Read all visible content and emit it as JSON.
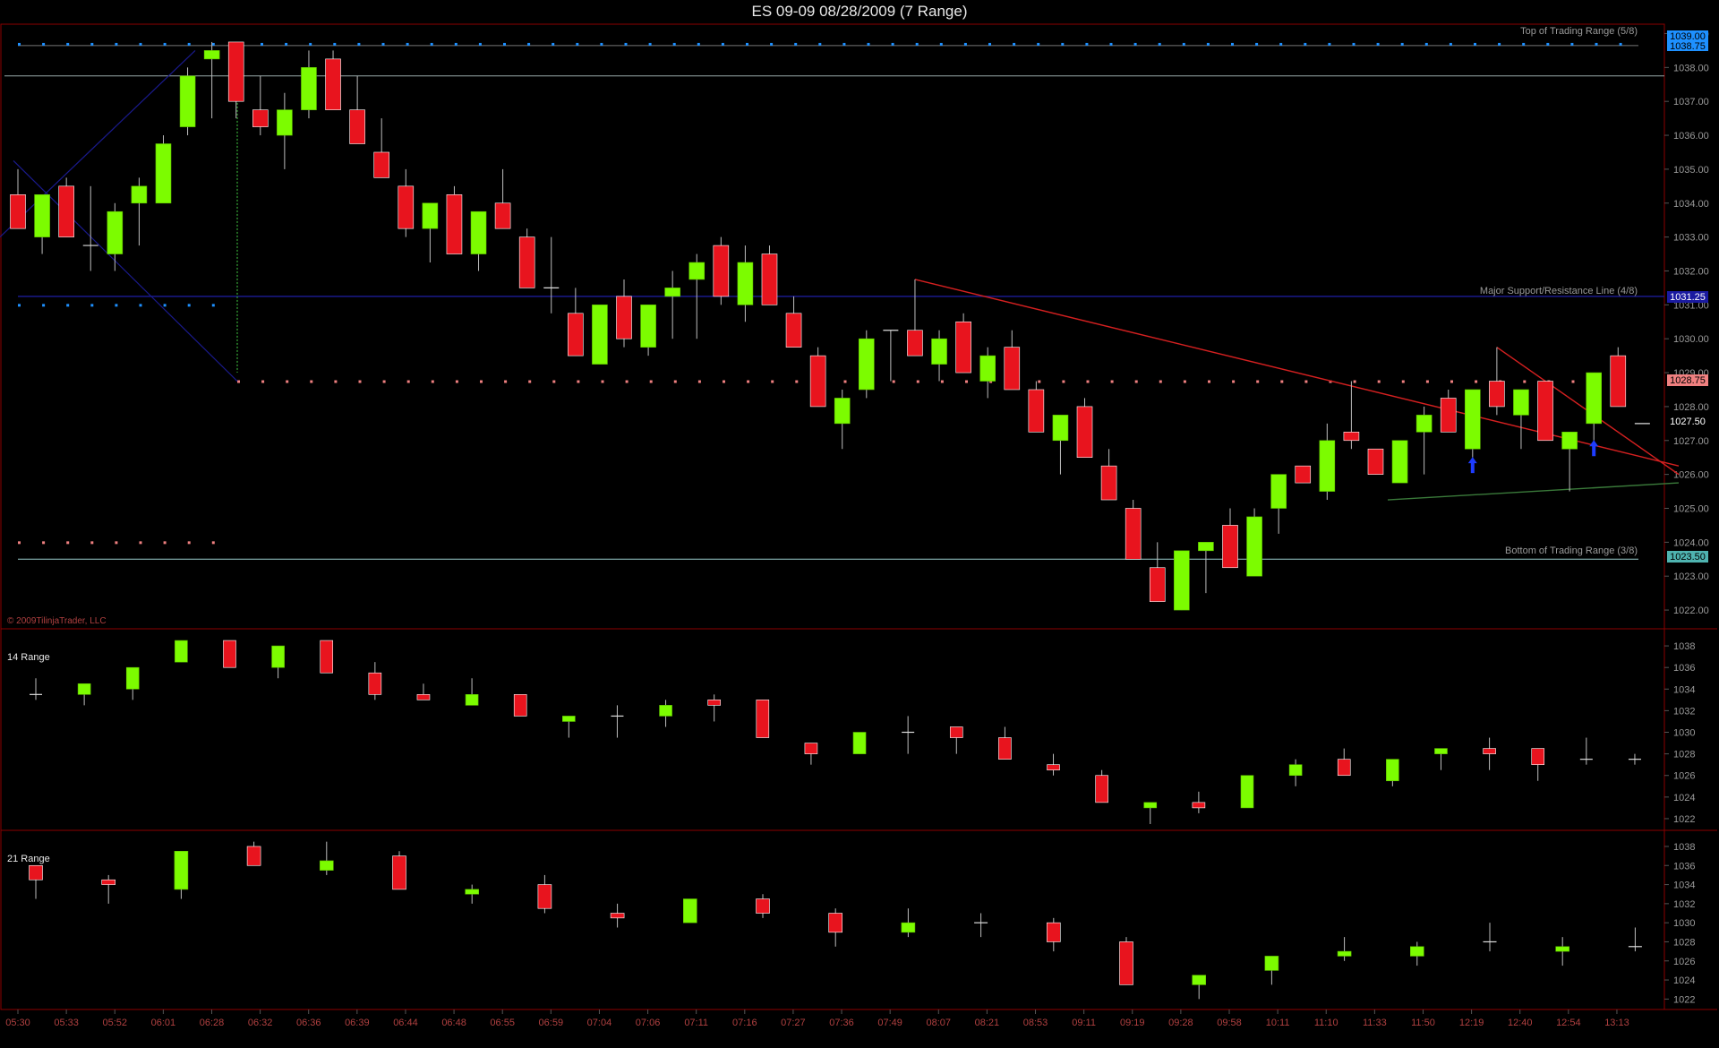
{
  "window": {
    "title": "ES 09-09  08/28/2009 (7 Range)"
  },
  "colors": {
    "up": "#7cfc00",
    "down": "#e8141e",
    "grid": "#8a8f8f",
    "frame": "#8b0000",
    "support": "#1a1a8c",
    "blueDots": "#1e90ff",
    "pinkDots": "#f08080",
    "trend": "#d42020",
    "greenLine": "#3a7a3a"
  },
  "panels": {
    "main": {
      "label": "",
      "copyright": "© 2009TilinjaTrader, LLC"
    },
    "p14": {
      "label": "14 Range"
    },
    "p21": {
      "label": "21 Range"
    }
  },
  "annotations": {
    "top": "Top of Trading Range (5/8)",
    "major": "Major Support/Resistance Line (4/8)",
    "bottom": "Bottom of Trading Range (3/8)"
  },
  "price_tags": {
    "top1": "1039.00",
    "top2": "1038.75",
    "major": "1031.25",
    "pink": "1028.75",
    "last": "1027.50",
    "bottom": "1023.50"
  },
  "chart_data": [
    {
      "type": "candlestick",
      "title": "ES 09-09  08/28/2009 (7 Range)",
      "ylim": [
        1021.5,
        1039.25
      ],
      "yticks": [
        "1039.00",
        "1038.00",
        "1037.00",
        "1036.00",
        "1035.00",
        "1034.00",
        "1033.00",
        "1032.00",
        "1031.00",
        "1030.00",
        "1029.00",
        "1028.00",
        "1027.00",
        "1026.00",
        "1025.00",
        "1024.00",
        "1023.00",
        "1022.00"
      ],
      "levels": [
        1038.75,
        1037.75,
        1031.25,
        1028.75,
        1024.0,
        1023.5
      ],
      "candles": [
        {
          "o": 1034.25,
          "h": 1035.0,
          "l": 1033.25,
          "c": 1033.25
        },
        {
          "o": 1033.0,
          "h": 1034.25,
          "l": 1032.5,
          "c": 1034.25
        },
        {
          "o": 1034.5,
          "h": 1034.75,
          "l": 1033.0,
          "c": 1033.0
        },
        {
          "o": 1032.75,
          "h": 1034.5,
          "l": 1032.0,
          "c": 1032.75
        },
        {
          "o": 1032.5,
          "h": 1034.0,
          "l": 1032.0,
          "c": 1033.75
        },
        {
          "o": 1034.0,
          "h": 1034.75,
          "l": 1032.75,
          "c": 1034.5
        },
        {
          "o": 1034.0,
          "h": 1036.0,
          "l": 1034.0,
          "c": 1035.75
        },
        {
          "o": 1036.25,
          "h": 1038.0,
          "l": 1036.0,
          "c": 1037.75
        },
        {
          "o": 1038.25,
          "h": 1038.75,
          "l": 1036.5,
          "c": 1038.5
        },
        {
          "o": 1038.75,
          "h": 1038.75,
          "l": 1036.5,
          "c": 1037.0
        },
        {
          "o": 1036.75,
          "h": 1037.75,
          "l": 1036.0,
          "c": 1036.25
        },
        {
          "o": 1036.0,
          "h": 1037.25,
          "l": 1035.0,
          "c": 1036.75
        },
        {
          "o": 1036.75,
          "h": 1038.5,
          "l": 1036.5,
          "c": 1038.0
        },
        {
          "o": 1038.25,
          "h": 1038.5,
          "l": 1036.75,
          "c": 1036.75
        },
        {
          "o": 1036.75,
          "h": 1037.75,
          "l": 1035.75,
          "c": 1035.75
        },
        {
          "o": 1035.5,
          "h": 1036.5,
          "l": 1034.75,
          "c": 1034.75
        },
        {
          "o": 1034.5,
          "h": 1035.0,
          "l": 1033.0,
          "c": 1033.25
        },
        {
          "o": 1033.25,
          "h": 1034.0,
          "l": 1032.25,
          "c": 1034.0
        },
        {
          "o": 1034.25,
          "h": 1034.5,
          "l": 1032.5,
          "c": 1032.5
        },
        {
          "o": 1032.5,
          "h": 1033.75,
          "l": 1032.0,
          "c": 1033.75
        },
        {
          "o": 1034.0,
          "h": 1035.0,
          "l": 1033.25,
          "c": 1033.25
        },
        {
          "o": 1033.0,
          "h": 1033.25,
          "l": 1031.5,
          "c": 1031.5
        },
        {
          "o": 1031.5,
          "h": 1033.0,
          "l": 1030.75,
          "c": 1031.5
        },
        {
          "o": 1030.75,
          "h": 1031.5,
          "l": 1029.5,
          "c": 1029.5
        },
        {
          "o": 1029.25,
          "h": 1031.0,
          "l": 1029.25,
          "c": 1031.0
        },
        {
          "o": 1031.25,
          "h": 1031.75,
          "l": 1029.75,
          "c": 1030.0
        },
        {
          "o": 1029.75,
          "h": 1031.0,
          "l": 1029.5,
          "c": 1031.0
        },
        {
          "o": 1031.25,
          "h": 1032.0,
          "l": 1030.0,
          "c": 1031.5
        },
        {
          "o": 1031.75,
          "h": 1032.5,
          "l": 1030.0,
          "c": 1032.25
        },
        {
          "o": 1032.75,
          "h": 1033.0,
          "l": 1031.0,
          "c": 1031.25
        },
        {
          "o": 1031.0,
          "h": 1032.75,
          "l": 1030.5,
          "c": 1032.25
        },
        {
          "o": 1032.5,
          "h": 1032.75,
          "l": 1031.0,
          "c": 1031.0
        },
        {
          "o": 1030.75,
          "h": 1031.25,
          "l": 1029.75,
          "c": 1029.75
        },
        {
          "o": 1029.5,
          "h": 1029.75,
          "l": 1028.0,
          "c": 1028.0
        },
        {
          "o": 1027.5,
          "h": 1028.5,
          "l": 1026.75,
          "c": 1028.25
        },
        {
          "o": 1028.5,
          "h": 1030.25,
          "l": 1028.25,
          "c": 1030.0
        },
        {
          "o": 1030.25,
          "h": 1030.25,
          "l": 1028.75,
          "c": 1030.25
        },
        {
          "o": 1030.25,
          "h": 1031.75,
          "l": 1029.5,
          "c": 1029.5
        },
        {
          "o": 1029.25,
          "h": 1030.25,
          "l": 1028.75,
          "c": 1030.0
        },
        {
          "o": 1030.5,
          "h": 1030.75,
          "l": 1029.0,
          "c": 1029.0
        },
        {
          "o": 1028.75,
          "h": 1029.75,
          "l": 1028.25,
          "c": 1029.5
        },
        {
          "o": 1029.75,
          "h": 1030.25,
          "l": 1028.5,
          "c": 1028.5
        },
        {
          "o": 1028.5,
          "h": 1028.75,
          "l": 1027.25,
          "c": 1027.25
        },
        {
          "o": 1027.0,
          "h": 1027.75,
          "l": 1026.0,
          "c": 1027.75
        },
        {
          "o": 1028.0,
          "h": 1028.25,
          "l": 1026.5,
          "c": 1026.5
        },
        {
          "o": 1026.25,
          "h": 1026.75,
          "l": 1025.25,
          "c": 1025.25
        },
        {
          "o": 1025.0,
          "h": 1025.25,
          "l": 1023.5,
          "c": 1023.5
        },
        {
          "o": 1023.25,
          "h": 1024.0,
          "l": 1022.25,
          "c": 1022.25
        },
        {
          "o": 1022.0,
          "h": 1023.75,
          "l": 1022.0,
          "c": 1023.75
        },
        {
          "o": 1023.75,
          "h": 1024.0,
          "l": 1022.5,
          "c": 1024.0
        },
        {
          "o": 1024.5,
          "h": 1025.0,
          "l": 1023.25,
          "c": 1023.25
        },
        {
          "o": 1023.0,
          "h": 1025.0,
          "l": 1023.0,
          "c": 1024.75
        },
        {
          "o": 1025.0,
          "h": 1026.0,
          "l": 1024.25,
          "c": 1026.0
        },
        {
          "o": 1026.25,
          "h": 1026.25,
          "l": 1025.75,
          "c": 1025.75
        },
        {
          "o": 1025.5,
          "h": 1027.5,
          "l": 1025.25,
          "c": 1027.0
        },
        {
          "o": 1027.25,
          "h": 1028.75,
          "l": 1026.75,
          "c": 1027.0
        },
        {
          "o": 1026.75,
          "h": 1026.75,
          "l": 1026.0,
          "c": 1026.0
        },
        {
          "o": 1025.75,
          "h": 1027.0,
          "l": 1025.75,
          "c": 1027.0
        },
        {
          "o": 1027.25,
          "h": 1028.0,
          "l": 1026.0,
          "c": 1027.75
        },
        {
          "o": 1028.25,
          "h": 1028.5,
          "l": 1027.25,
          "c": 1027.25
        },
        {
          "o": 1026.75,
          "h": 1028.25,
          "l": 1026.5,
          "c": 1028.5
        },
        {
          "o": 1028.75,
          "h": 1029.75,
          "l": 1027.75,
          "c": 1028.0
        },
        {
          "o": 1027.75,
          "h": 1028.5,
          "l": 1026.75,
          "c": 1028.5
        },
        {
          "o": 1028.75,
          "h": 1028.75,
          "l": 1027.0,
          "c": 1027.0
        },
        {
          "o": 1026.75,
          "h": 1027.25,
          "l": 1025.5,
          "c": 1027.25
        },
        {
          "o": 1027.5,
          "h": 1029.0,
          "l": 1027.0,
          "c": 1029.0
        },
        {
          "o": 1029.5,
          "h": 1029.75,
          "l": 1028.0,
          "c": 1028.0
        },
        {
          "o": 1027.5,
          "h": 1027.5,
          "l": 1027.5,
          "c": 1027.5
        }
      ],
      "trendlines": [
        {
          "x1": 37,
          "y1": 1031.75,
          "x2": 68.5,
          "y2": 1026.25
        },
        {
          "x1": 61,
          "y1": 1029.75,
          "x2": 68.5,
          "y2": 1026.0
        },
        {
          "x1": 56.5,
          "y1": 1025.25,
          "x2": 68.5,
          "y2": 1025.75
        }
      ],
      "signals": [
        {
          "i": 60,
          "dir": "up",
          "y": 1026.25
        },
        {
          "i": 65,
          "dir": "up",
          "y": 1026.75
        }
      ]
    },
    {
      "type": "candlestick",
      "title": "14 Range",
      "ylim": [
        1021.0,
        1039.5
      ],
      "yticks": [
        "1038",
        "1036",
        "1034",
        "1032",
        "1030",
        "1028",
        "1026",
        "1024",
        "1022"
      ],
      "candles": [
        {
          "o": 1033.5,
          "h": 1035.0,
          "l": 1033.0,
          "c": 1033.5
        },
        {
          "o": 1033.5,
          "h": 1034.5,
          "l": 1032.5,
          "c": 1034.5
        },
        {
          "o": 1034.0,
          "h": 1036.0,
          "l": 1033.0,
          "c": 1036.0
        },
        {
          "o": 1036.5,
          "h": 1038.5,
          "l": 1036.5,
          "c": 1038.5
        },
        {
          "o": 1038.5,
          "h": 1038.5,
          "l": 1036.0,
          "c": 1036.0
        },
        {
          "o": 1036.0,
          "h": 1038.0,
          "l": 1035.0,
          "c": 1038.0
        },
        {
          "o": 1038.5,
          "h": 1038.5,
          "l": 1035.5,
          "c": 1035.5
        },
        {
          "o": 1035.5,
          "h": 1036.5,
          "l": 1033.0,
          "c": 1033.5
        },
        {
          "o": 1033.5,
          "h": 1034.5,
          "l": 1033.0,
          "c": 1033.0
        },
        {
          "o": 1032.5,
          "h": 1035.0,
          "l": 1032.5,
          "c": 1033.5
        },
        {
          "o": 1033.5,
          "h": 1033.5,
          "l": 1031.5,
          "c": 1031.5
        },
        {
          "o": 1031.0,
          "h": 1031.5,
          "l": 1029.5,
          "c": 1031.5
        },
        {
          "o": 1031.5,
          "h": 1032.5,
          "l": 1029.5,
          "c": 1031.5
        },
        {
          "o": 1031.5,
          "h": 1033.0,
          "l": 1030.5,
          "c": 1032.5
        },
        {
          "o": 1033.0,
          "h": 1033.5,
          "l": 1031.0,
          "c": 1032.5
        },
        {
          "o": 1033.0,
          "h": 1033.0,
          "l": 1029.5,
          "c": 1029.5
        },
        {
          "o": 1029.0,
          "h": 1029.0,
          "l": 1027.0,
          "c": 1028.0
        },
        {
          "o": 1028.0,
          "h": 1030.0,
          "l": 1028.0,
          "c": 1030.0
        },
        {
          "o": 1030.0,
          "h": 1031.5,
          "l": 1028.0,
          "c": 1030.0
        },
        {
          "o": 1030.5,
          "h": 1030.5,
          "l": 1028.0,
          "c": 1029.5
        },
        {
          "o": 1029.5,
          "h": 1030.5,
          "l": 1027.5,
          "c": 1027.5
        },
        {
          "o": 1027.0,
          "h": 1028.0,
          "l": 1026.0,
          "c": 1026.5
        },
        {
          "o": 1026.0,
          "h": 1026.5,
          "l": 1023.5,
          "c": 1023.5
        },
        {
          "o": 1023.0,
          "h": 1023.5,
          "l": 1021.5,
          "c": 1023.5
        },
        {
          "o": 1023.5,
          "h": 1024.5,
          "l": 1022.5,
          "c": 1023.0
        },
        {
          "o": 1023.0,
          "h": 1026.0,
          "l": 1023.0,
          "c": 1026.0
        },
        {
          "o": 1026.0,
          "h": 1027.5,
          "l": 1025.0,
          "c": 1027.0
        },
        {
          "o": 1027.5,
          "h": 1028.5,
          "l": 1026.0,
          "c": 1026.0
        },
        {
          "o": 1025.5,
          "h": 1027.5,
          "l": 1025.0,
          "c": 1027.5
        },
        {
          "o": 1028.0,
          "h": 1028.5,
          "l": 1026.5,
          "c": 1028.5
        },
        {
          "o": 1028.5,
          "h": 1029.5,
          "l": 1026.5,
          "c": 1028.0
        },
        {
          "o": 1028.5,
          "h": 1028.5,
          "l": 1025.5,
          "c": 1027.0
        },
        {
          "o": 1027.5,
          "h": 1029.5,
          "l": 1027.0,
          "c": 1027.5
        },
        {
          "o": 1027.5,
          "h": 1028.0,
          "l": 1027.0,
          "c": 1027.5
        }
      ]
    },
    {
      "type": "candlestick",
      "title": "21 Range",
      "ylim": [
        1021.0,
        1039.5
      ],
      "yticks": [
        "1038",
        "1036",
        "1034",
        "1032",
        "1030",
        "1028",
        "1026",
        "1024",
        "1022"
      ],
      "candles": [
        {
          "o": 1036.0,
          "h": 1036.0,
          "l": 1032.5,
          "c": 1034.5
        },
        {
          "o": 1034.5,
          "h": 1035.0,
          "l": 1032.0,
          "c": 1034.0
        },
        {
          "o": 1033.5,
          "h": 1037.5,
          "l": 1032.5,
          "c": 1037.5
        },
        {
          "o": 1038.0,
          "h": 1038.5,
          "l": 1036.0,
          "c": 1036.0
        },
        {
          "o": 1035.5,
          "h": 1038.5,
          "l": 1035.0,
          "c": 1036.5
        },
        {
          "o": 1037.0,
          "h": 1037.5,
          "l": 1033.5,
          "c": 1033.5
        },
        {
          "o": 1033.0,
          "h": 1034.0,
          "l": 1032.0,
          "c": 1033.5
        },
        {
          "o": 1034.0,
          "h": 1035.0,
          "l": 1031.0,
          "c": 1031.5
        },
        {
          "o": 1031.0,
          "h": 1032.0,
          "l": 1029.5,
          "c": 1030.5
        },
        {
          "o": 1030.0,
          "h": 1032.5,
          "l": 1030.0,
          "c": 1032.5
        },
        {
          "o": 1032.5,
          "h": 1033.0,
          "l": 1030.5,
          "c": 1031.0
        },
        {
          "o": 1031.0,
          "h": 1031.5,
          "l": 1027.5,
          "c": 1029.0
        },
        {
          "o": 1029.0,
          "h": 1031.5,
          "l": 1028.5,
          "c": 1030.0
        },
        {
          "o": 1030.0,
          "h": 1031.0,
          "l": 1028.5,
          "c": 1030.0
        },
        {
          "o": 1030.0,
          "h": 1030.5,
          "l": 1027.0,
          "c": 1028.0
        },
        {
          "o": 1028.0,
          "h": 1028.5,
          "l": 1023.5,
          "c": 1023.5
        },
        {
          "o": 1023.5,
          "h": 1024.5,
          "l": 1022.0,
          "c": 1024.5
        },
        {
          "o": 1025.0,
          "h": 1026.5,
          "l": 1023.5,
          "c": 1026.5
        },
        {
          "o": 1026.5,
          "h": 1028.5,
          "l": 1026.0,
          "c": 1027.0
        },
        {
          "o": 1026.5,
          "h": 1028.0,
          "l": 1025.5,
          "c": 1027.5
        },
        {
          "o": 1028.0,
          "h": 1030.0,
          "l": 1027.0,
          "c": 1028.0
        },
        {
          "o": 1027.0,
          "h": 1028.5,
          "l": 1025.5,
          "c": 1027.5
        },
        {
          "o": 1027.5,
          "h": 1029.5,
          "l": 1027.0,
          "c": 1027.5
        }
      ]
    }
  ],
  "time_axis": [
    "05:30",
    "05:33",
    "05:52",
    "06:01",
    "06:28",
    "06:32",
    "06:36",
    "06:39",
    "06:44",
    "06:48",
    "06:55",
    "06:59",
    "07:04",
    "07:06",
    "07:11",
    "07:16",
    "07:27",
    "07:36",
    "07:49",
    "08:07",
    "08:21",
    "08:53",
    "09:11",
    "09:19",
    "09:28",
    "09:58",
    "10:11",
    "11:10",
    "11:33",
    "11:50",
    "12:19",
    "12:40",
    "12:54",
    "13:13"
  ]
}
